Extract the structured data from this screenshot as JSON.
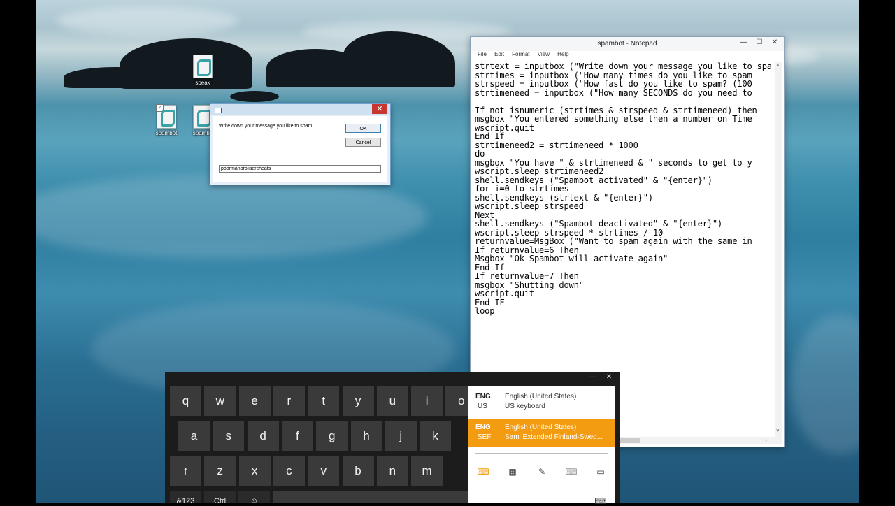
{
  "desktop": {
    "icons": [
      {
        "label": "speak"
      },
      {
        "label": "spambot"
      },
      {
        "label": "spambo"
      }
    ]
  },
  "dialog": {
    "prompt": "Write down your message you like to spam",
    "ok_label": "OK",
    "cancel_label": "Cancel",
    "input_value": "poormanbrolisercheats",
    "close_glyph": "✕"
  },
  "notepad": {
    "title": "spambot - Notepad",
    "menu": [
      "File",
      "Edit",
      "Format",
      "View",
      "Help"
    ],
    "controls": {
      "minimize": "—",
      "maximize": "☐",
      "close": "✕"
    },
    "lines": [
      "strtext = inputbox (\"Write down your message you like to spam",
      "strtimes = inputbox (\"How many times do you like to spam",
      "strspeed = inputbox (\"How fast do you like to spam? (100",
      "strtimeneed = inputbox (\"How many SECONDS do you need to",
      "",
      "If not isnumeric (strtimes & strspeed & strtimeneed) then",
      "msgbox \"You entered something else then a number on Time",
      "wscript.quit",
      "End If",
      "strtimeneed2 = strtimeneed * 1000",
      "do",
      "msgbox \"You have \" & strtimeneed & \" seconds to get to y",
      "wscript.sleep strtimeneed2",
      "shell.sendkeys (\"Spambot activated\" & \"{enter}\")",
      "for i=0 to strtimes",
      "shell.sendkeys (strtext & \"{enter}\")",
      "wscript.sleep strspeed",
      "Next",
      "shell.sendkeys (\"Spambot deactivated\" & \"{enter}\")",
      "wscript.sleep strspeed * strtimes / 10",
      "returnvalue=MsgBox (\"Want to spam again with the same in",
      "If returnvalue=6 Then",
      "Msgbox \"Ok Spambot will activate again\"",
      "End If",
      "If returnvalue=7 Then",
      "msgbox \"Shutting down\"",
      "wscript.quit",
      "End IF",
      "loop"
    ]
  },
  "keyboard": {
    "controls": {
      "minimize": "—",
      "close": "✕"
    },
    "row1": [
      "q",
      "w",
      "e",
      "r",
      "t",
      "y",
      "u",
      "i",
      "o"
    ],
    "row2": [
      "a",
      "s",
      "d",
      "f",
      "g",
      "h",
      "j",
      "k"
    ],
    "row3": [
      "↑",
      "z",
      "x",
      "c",
      "v",
      "b",
      "n",
      "m"
    ],
    "row4": [
      "&123",
      "Ctrl",
      "☺"
    ]
  },
  "language_menu": {
    "items": [
      {
        "code": "ENG",
        "sub": "US",
        "name": "English (United States)",
        "layout": "US keyboard",
        "active": false
      },
      {
        "code": "ENG",
        "sub": "SEF",
        "name": "English (United States)",
        "layout": "Sami Extended Finland-Swed...",
        "active": true
      }
    ],
    "modes": [
      "standard-keyboard-icon",
      "split-keyboard-icon",
      "handwriting-icon",
      "full-keyboard-icon",
      "dock-icon"
    ],
    "accent": "#f39c12"
  }
}
